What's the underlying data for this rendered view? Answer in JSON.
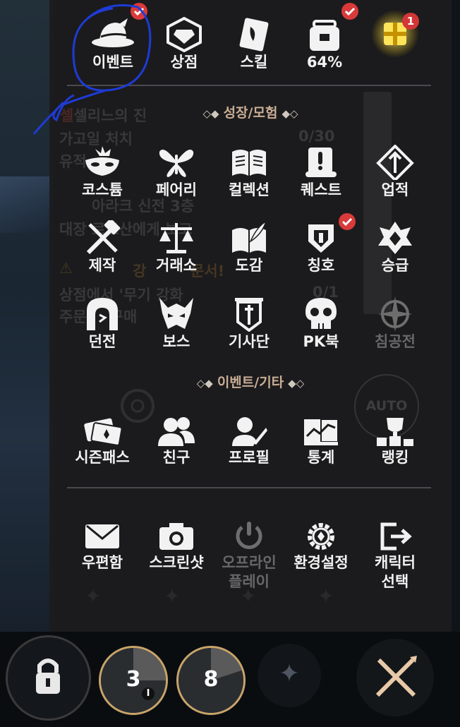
{
  "top_bar": [
    {
      "label": "이벤트",
      "icon": "hat-icon",
      "badge": "check"
    },
    {
      "label": "상점",
      "icon": "shop-icon",
      "badge": ""
    },
    {
      "label": "스킬",
      "icon": "skill-book-icon",
      "badge": ""
    },
    {
      "label": "64%",
      "icon": "bag-icon",
      "badge": "check"
    },
    {
      "label": "",
      "icon": "gift-box-icon",
      "badge": "1"
    }
  ],
  "section_growth": {
    "title": "성장/모험",
    "deco_left": "◇◆",
    "deco_right": "◆◇"
  },
  "growth_items": [
    {
      "label": "코스튬",
      "icon": "mask-icon",
      "disabled": false
    },
    {
      "label": "페어리",
      "icon": "fairy-icon",
      "disabled": false
    },
    {
      "label": "컬렉션",
      "icon": "collection-book-icon",
      "disabled": false
    },
    {
      "label": "퀘스트",
      "icon": "quest-scroll-icon",
      "disabled": false
    },
    {
      "label": "업적",
      "icon": "achievement-icon",
      "disabled": false
    },
    {
      "label": "제작",
      "icon": "craft-hammer-icon",
      "disabled": false
    },
    {
      "label": "거래소",
      "icon": "scales-icon",
      "disabled": false
    },
    {
      "label": "도감",
      "icon": "codex-book-icon",
      "disabled": false
    },
    {
      "label": "칭호",
      "icon": "title-emblem-icon",
      "disabled": false,
      "badge": "check"
    },
    {
      "label": "승급",
      "icon": "promotion-crest-icon",
      "disabled": false
    },
    {
      "label": "던전",
      "icon": "dungeon-icon",
      "disabled": false
    },
    {
      "label": "보스",
      "icon": "boss-icon",
      "disabled": false
    },
    {
      "label": "기사단",
      "icon": "knights-banner-icon",
      "disabled": false
    },
    {
      "label": "PK북",
      "icon": "skull-icon",
      "disabled": false
    },
    {
      "label": "침공전",
      "icon": "invasion-compass-icon",
      "disabled": true
    }
  ],
  "section_event": {
    "title": "이벤트/기타",
    "deco_left": "◇◆",
    "deco_right": "◆◇"
  },
  "event_items": [
    {
      "label": "시즌패스",
      "icon": "season-pass-icon"
    },
    {
      "label": "친구",
      "icon": "friends-icon"
    },
    {
      "label": "프로필",
      "icon": "profile-icon"
    },
    {
      "label": "통계",
      "icon": "statistics-icon"
    },
    {
      "label": "랭킹",
      "icon": "ranking-trophy-icon"
    }
  ],
  "system_items": [
    {
      "label": "우편함",
      "icon": "mail-icon",
      "disabled": false
    },
    {
      "label": "스크린샷",
      "icon": "camera-icon",
      "disabled": false
    },
    {
      "label": "오프라인\n플레이",
      "line1": "오프라인",
      "line2": "플레이",
      "icon": "power-icon",
      "disabled": true
    },
    {
      "label": "환경설정",
      "icon": "settings-gear-icon",
      "disabled": false
    },
    {
      "label": "캐릭터\n선택",
      "line1": "캐릭터",
      "line2": "선택",
      "icon": "exit-icon",
      "disabled": false
    }
  ],
  "background_quest_text": {
    "q1_title": "셀리느의 진",
    "q1_line1": "가고일 처치",
    "q1_line1_value": "0/30",
    "q1_line2": "유적",
    "q2_title": "아라크 신전 3층",
    "q2_line1": "대장 로르산에게 보고",
    "q3_title": "강",
    "q3_title_suffix": "문서!",
    "q3_line1": "상점에서 '무기 강화",
    "q3_line1_value": "0/1",
    "q3_line2": "주문서' 구매",
    "auto_label": "AUTO"
  },
  "hud": {
    "lock_icon": "lock-icon",
    "slot1": {
      "count": "3",
      "sub": "I"
    },
    "slot2": {
      "count": "8"
    },
    "empty_slot_icon": "sparkle-icon",
    "weapon_icon": "crossed-weapon-icon"
  },
  "colors": {
    "panel": "#1c1c1e",
    "accent_red": "#d93a3a",
    "section": "#c9ad95",
    "disabled": "#676767",
    "scribble": "#1e3bd6"
  }
}
